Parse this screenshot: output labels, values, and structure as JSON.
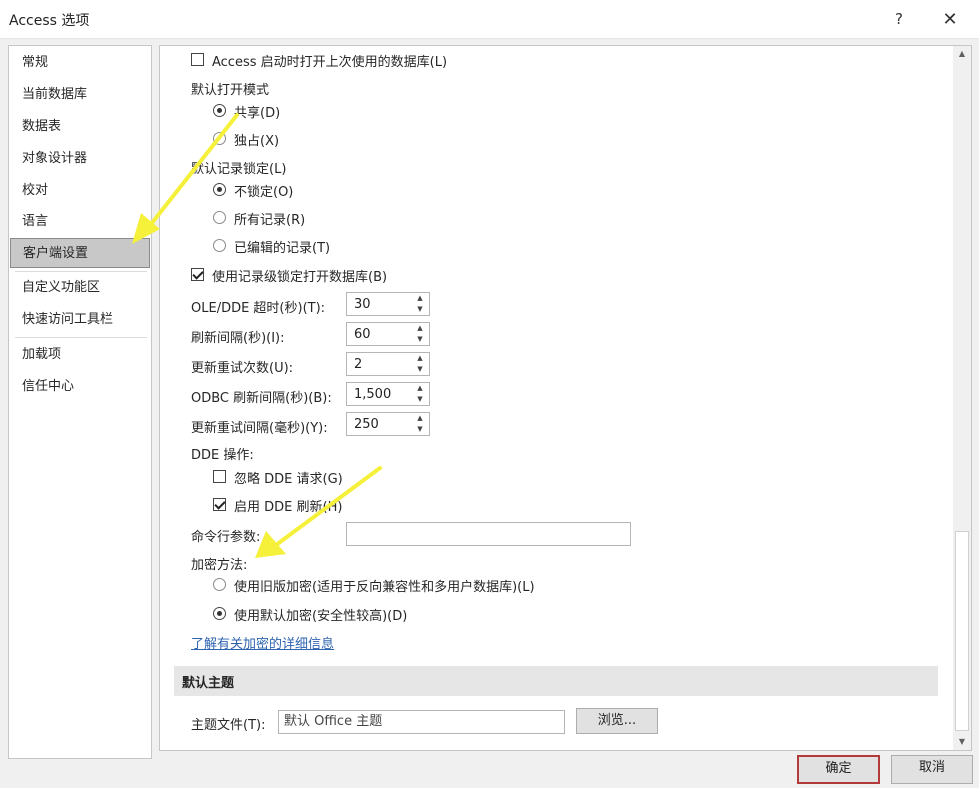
{
  "window": {
    "title": "Access 选项",
    "help_label": "?",
    "close_label": "✕"
  },
  "nav": {
    "items": [
      {
        "label": "常规"
      },
      {
        "label": "当前数据库"
      },
      {
        "label": "数据表"
      },
      {
        "label": "对象设计器"
      },
      {
        "label": "校对"
      },
      {
        "label": "语言"
      },
      {
        "label": "客户端设置",
        "selected": true
      },
      {
        "label": "自定义功能区"
      },
      {
        "label": "快速访问工具栏"
      },
      {
        "label": "加载项"
      },
      {
        "label": "信任中心"
      }
    ]
  },
  "client": {
    "open_last_db": {
      "label": "Access 启动时打开上次使用的数据库(L)",
      "checked": false
    },
    "default_open_mode": {
      "label": "默认打开模式",
      "options": [
        {
          "label": "共享(D)",
          "checked": true
        },
        {
          "label": "独占(X)",
          "checked": false
        }
      ]
    },
    "default_record_locking": {
      "label": "默认记录锁定(L)",
      "options": [
        {
          "label": "不锁定(O)",
          "checked": true
        },
        {
          "label": "所有记录(R)",
          "checked": false
        },
        {
          "label": "已编辑的记录(T)",
          "checked": false
        }
      ]
    },
    "record_level_locking": {
      "label": "使用记录级锁定打开数据库(B)",
      "checked": true
    },
    "spinners": [
      {
        "label": "OLE/DDE 超时(秒)(T):",
        "value": "30"
      },
      {
        "label": "刷新间隔(秒)(I):",
        "value": "60"
      },
      {
        "label": "更新重试次数(U):",
        "value": "2"
      },
      {
        "label": "ODBC 刷新间隔(秒)(B):",
        "value": "1,500"
      },
      {
        "label": "更新重试间隔(毫秒)(Y):",
        "value": "250"
      }
    ],
    "dde": {
      "label": "DDE 操作:",
      "ignore": {
        "label": "忽略 DDE 请求(G)",
        "checked": false
      },
      "enable_refresh": {
        "label": "启用 DDE 刷新(H)",
        "checked": true
      }
    },
    "command_line": {
      "label": "命令行参数:",
      "value": ""
    },
    "encryption": {
      "label": "加密方法:",
      "options": [
        {
          "label": "使用旧版加密(适用于反向兼容性和多用户数据库)(L)",
          "checked": false
        },
        {
          "label": "使用默认加密(安全性较高)(D)",
          "checked": true
        }
      ],
      "link": "了解有关加密的详细信息"
    },
    "default_theme": {
      "header": "默认主题",
      "file_label": "主题文件(T):",
      "file_value": "默认 Office 主题",
      "browse_label": "浏览..."
    }
  },
  "footer": {
    "ok_label": "确定",
    "cancel_label": "取消"
  },
  "colors": {
    "annotation_arrow": "#f5f03a",
    "ok_border": "#b33a3a",
    "link": "#2e63b0"
  }
}
